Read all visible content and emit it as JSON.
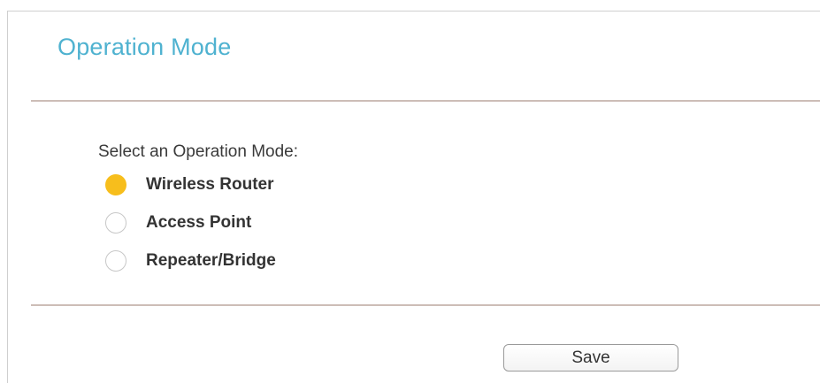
{
  "page": {
    "title": "Operation Mode"
  },
  "form": {
    "prompt": "Select an Operation Mode:",
    "options": [
      {
        "label": "Wireless Router",
        "selected": true
      },
      {
        "label": "Access Point",
        "selected": false
      },
      {
        "label": "Repeater/Bridge",
        "selected": false
      }
    ]
  },
  "actions": {
    "save_label": "Save"
  },
  "colors": {
    "title": "#4fb2d0",
    "radio_selected": "#f7be1c",
    "divider": "#cdbdb7"
  }
}
